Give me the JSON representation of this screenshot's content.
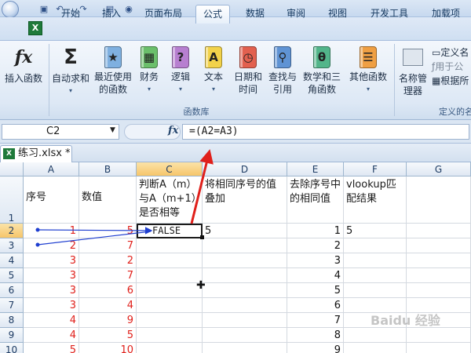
{
  "ribbon_tabs": [
    "开始",
    "插入",
    "页面布局",
    "公式",
    "数据",
    "审阅",
    "视图",
    "开发工具",
    "加载项"
  ],
  "active_tab": "公式",
  "ribbon": {
    "insert_function": "插入函数",
    "autosum": "自动求和",
    "recent": "最近使用的函数",
    "financial": "财务",
    "logical": "逻辑",
    "text": "文本",
    "datetime": "日期和时间",
    "lookup": "查找与引用",
    "math": "数学和三角函数",
    "more": "其他函数",
    "name_manager": "名称管理器",
    "define_name": "定义名",
    "use_in_formula": "用于公",
    "create_from_selection": "根据所",
    "group_function_library": "函数库",
    "group_defined_names": "定义的名"
  },
  "formula_bar": {
    "name_box": "C2",
    "fx": "fx",
    "formula": "=(A2=A3)"
  },
  "workbook": {
    "tab_label": "练习.xlsx *"
  },
  "columns": [
    "A",
    "B",
    "C",
    "D",
    "E",
    "F",
    "G"
  ],
  "selected_column": "C",
  "selected_row": "2",
  "rows": [
    "1",
    "2",
    "3",
    "4",
    "5",
    "6",
    "7",
    "8",
    "9",
    "10"
  ],
  "headers": {
    "A": "序号",
    "B": "数值",
    "C": "判断A（m）与A（m+1）是否相等",
    "D": "将相同序号的值叠加",
    "E": "去除序号中的相同值",
    "F": "vlookup匹配结果"
  },
  "data": {
    "A": [
      "1",
      "2",
      "3",
      "3",
      "3",
      "3",
      "4",
      "4",
      "5"
    ],
    "B": [
      "5",
      "7",
      "2",
      "7",
      "6",
      "4",
      "9",
      "5",
      "10"
    ],
    "C2": "FALSE",
    "D2": "5",
    "E": [
      "1",
      "2",
      "3",
      "4",
      "5",
      "6",
      "7",
      "8",
      "9"
    ],
    "F2": "5"
  },
  "watermark": "Baidu 经验",
  "colors": {
    "accent_red": "#e0201b",
    "arrow_blue": "#1f3fd0"
  }
}
